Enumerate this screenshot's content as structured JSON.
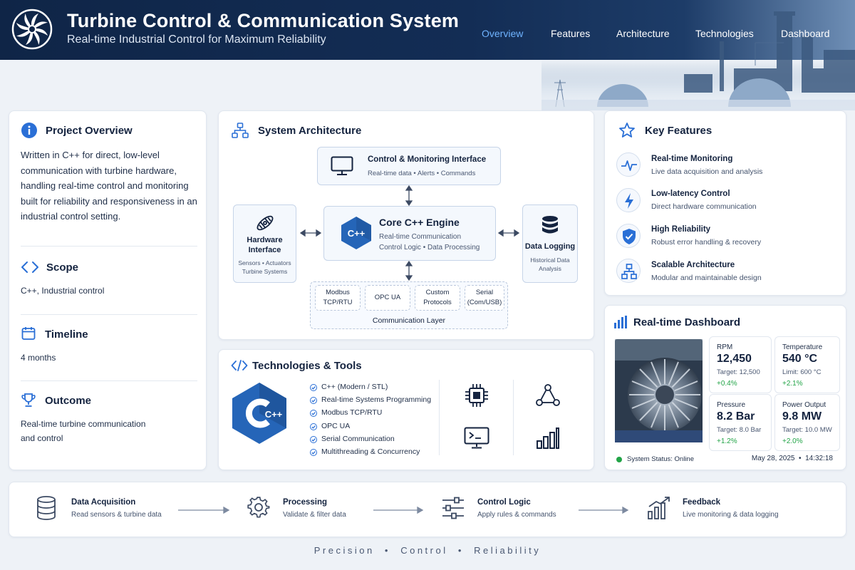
{
  "header": {
    "title": "Turbine Control & Communication System",
    "subtitle": "Real-time Industrial Control for Maximum Reliability",
    "nav": [
      {
        "label": "Overview",
        "active": true
      },
      {
        "label": "Features",
        "active": false
      },
      {
        "label": "Architecture",
        "active": false
      },
      {
        "label": "Technologies",
        "active": false
      },
      {
        "label": "Dashboard",
        "active": false
      }
    ]
  },
  "overview": {
    "title": "Project Overview",
    "description": "Written in C++ for direct, low-level communication with turbine hardware, handling real-time control and monitoring built for reliability and responsiveness in an industrial control setting.",
    "scope_title": "Scope",
    "scope_value": "C++, Industrial control",
    "timeline_title": "Timeline",
    "timeline_value": "4 months",
    "outcome_title": "Outcome",
    "outcome_line1": "Real-time turbine communication",
    "outcome_line2": "and control"
  },
  "architecture": {
    "title": "System Architecture",
    "interface": {
      "title": "Control & Monitoring Interface",
      "sub": "Real-time data  •  Alerts  •  Commands"
    },
    "engine": {
      "title": "Core C++ Engine",
      "line1": "Real-time Communication",
      "line2": "Control Logic  •  Data Processing",
      "logo_text": "C++"
    },
    "hardware": {
      "title1": "Hardware",
      "title2": "Interface",
      "sub1": "Sensors  •  Actuators",
      "sub2": "Turbine Systems"
    },
    "logging": {
      "title": "Data Logging",
      "sub1": "Historical Data",
      "sub2": "Analysis"
    },
    "protocols": [
      {
        "line1": "Modbus",
        "line2": "TCP/RTU"
      },
      {
        "line1": "OPC UA",
        "line2": ""
      },
      {
        "line1": "Custom",
        "line2": "Protocols"
      },
      {
        "line1": "Serial",
        "line2": "(Com/USB)"
      }
    ],
    "layer_label": "Communication Layer"
  },
  "technologies": {
    "title": "Technologies & Tools",
    "logo_text": "C++",
    "items": [
      "C++ (Modern / STL)",
      "Real-time Systems Programming",
      "Modbus TCP/RTU",
      "OPC UA",
      "Serial Communication",
      "Multithreading & Concurrency"
    ]
  },
  "features": {
    "title": "Key Features",
    "items": [
      {
        "title": "Real-time Monitoring",
        "desc": "Live data acquisition and analysis",
        "icon": "pulse-icon"
      },
      {
        "title": "Low-latency Control",
        "desc": "Direct hardware communication",
        "icon": "lightning-icon"
      },
      {
        "title": "High Reliability",
        "desc": "Robust error handling & recovery",
        "icon": "shield-icon"
      },
      {
        "title": "Scalable Architecture",
        "desc": "Modular and maintainable design",
        "icon": "hierarchy-icon"
      }
    ]
  },
  "dashboard": {
    "title": "Real-time Dashboard",
    "metrics": [
      {
        "label": "RPM",
        "value": "12,450",
        "target": "Target: 12,500",
        "delta": "+0.4%"
      },
      {
        "label": "Temperature",
        "value": "540 °C",
        "target": "Limit: 600 °C",
        "delta": "+2.1%"
      },
      {
        "label": "Pressure",
        "value": "8.2 Bar",
        "target": "Target: 8.0 Bar",
        "delta": "+1.2%"
      },
      {
        "label": "Power Output",
        "value": "9.8 MW",
        "target": "Target: 10.0 MW",
        "delta": "+2.0%"
      }
    ],
    "status": "System Status: Online",
    "datetime": "May 28, 2025  •  14:32:18",
    "colors": {
      "online": "#22a447",
      "delta": "#22a447"
    }
  },
  "pipeline": [
    {
      "title": "Data Acquisition",
      "desc": "Read sensors & turbine data",
      "icon": "database-icon"
    },
    {
      "title": "Processing",
      "desc": "Validate & filter data",
      "icon": "gear-icon"
    },
    {
      "title": "Control Logic",
      "desc": "Apply rules & commands",
      "icon": "sliders-icon"
    },
    {
      "title": "Feedback",
      "desc": "Live monitoring & data logging",
      "icon": "growth-chart-icon"
    }
  ],
  "footer": {
    "tagline": "Precision  •  Control  •  Reliability"
  },
  "theme": {
    "accent": "#2a6fd6",
    "header_bg": "#0f2547",
    "nav_active": "#6fb3ff"
  }
}
